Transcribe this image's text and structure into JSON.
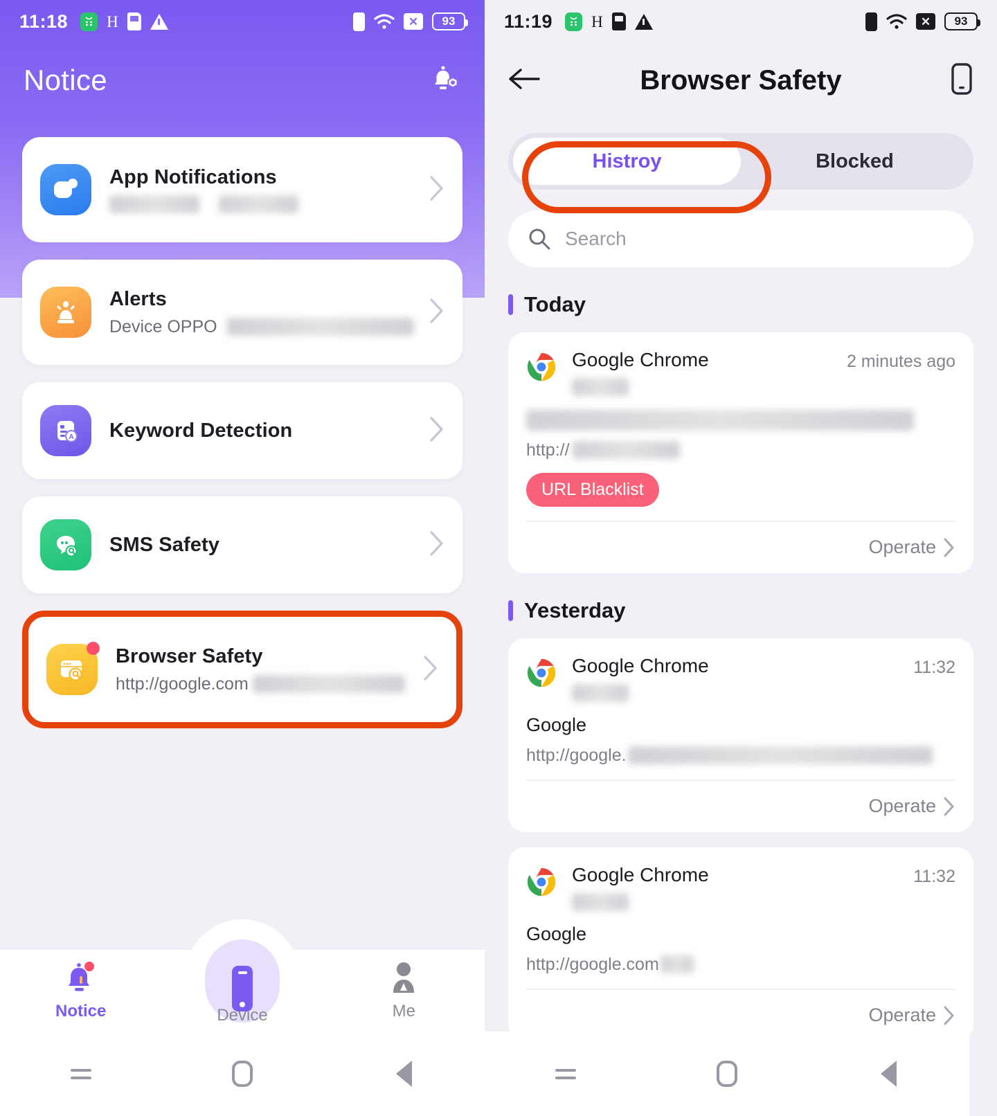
{
  "left": {
    "status_bar": {
      "time": "11:18",
      "icons": [
        "green-app-icon",
        "network-h-icon",
        "sim-card-icon",
        "warning-triangle-icon"
      ],
      "right_icons": [
        "vibrate-icon",
        "wifi-icon",
        "signal-x-icon"
      ],
      "battery_level": "93"
    },
    "header": {
      "title": "Notice",
      "action_icon": "bell-settings-icon"
    },
    "items": [
      {
        "title": "App Notifications",
        "subtitle": "",
        "subtitle_redacted": true,
        "icon": "app-notifications-icon",
        "badge": false,
        "chevron": "chevron-right-icon"
      },
      {
        "title": "Alerts",
        "subtitle": "Device OPPO",
        "subtitle_redacted": true,
        "icon": "alerts-siren-icon",
        "badge": false,
        "chevron": "chevron-right-icon"
      },
      {
        "title": "Keyword Detection",
        "subtitle": "",
        "subtitle_redacted": false,
        "icon": "keyword-detection-icon",
        "badge": false,
        "chevron": "chevron-right-icon"
      },
      {
        "title": "SMS Safety",
        "subtitle": "",
        "subtitle_redacted": false,
        "icon": "sms-safety-icon",
        "badge": false,
        "chevron": "chevron-right-icon"
      },
      {
        "title": "Browser Safety",
        "subtitle": "http://google.com",
        "subtitle_redacted": true,
        "icon": "browser-safety-icon",
        "badge": true,
        "chevron": "chevron-right-icon",
        "highlighted": true
      }
    ],
    "bottom_nav": [
      {
        "label": "Notice",
        "icon": "bell-icon",
        "active": true,
        "badge": true
      },
      {
        "label": "Device",
        "icon": "phone-icon",
        "active": false,
        "badge": false
      },
      {
        "label": "Me",
        "icon": "person-icon",
        "active": false,
        "badge": false
      }
    ],
    "android_nav": [
      "recents-icon",
      "home-icon",
      "back-icon"
    ]
  },
  "right": {
    "status_bar": {
      "time": "11:19",
      "icons": [
        "green-app-icon",
        "network-h-icon",
        "sim-card-icon",
        "warning-triangle-icon"
      ],
      "right_icons": [
        "vibrate-icon",
        "wifi-icon",
        "signal-x-icon"
      ],
      "battery_level": "93"
    },
    "header": {
      "title": "Browser Safety",
      "back_icon": "back-arrow-icon",
      "action_icon": "device-phone-icon"
    },
    "tabs": [
      {
        "label": "Histroy",
        "active": true,
        "highlighted": true
      },
      {
        "label": "Blocked",
        "active": false,
        "highlighted": false
      }
    ],
    "search": {
      "placeholder": "Search",
      "value": "",
      "icon": "search-icon"
    },
    "sections": [
      {
        "title": "Today",
        "cards": [
          {
            "app": "Google Chrome",
            "app_sub_redacted": true,
            "time": "2 minutes ago",
            "title": "",
            "title_redacted": true,
            "url": "http://",
            "url_redacted": true,
            "badge": "URL Blacklist",
            "badge_color": "#FA6179",
            "operate_label": "Operate",
            "icon": "chrome-icon"
          }
        ]
      },
      {
        "title": "Yesterday",
        "cards": [
          {
            "app": "Google Chrome",
            "app_sub_redacted": true,
            "time": "11:32",
            "title": "Google",
            "title_redacted": false,
            "url": "http://google.",
            "url_redacted": true,
            "badge": "",
            "operate_label": "Operate",
            "icon": "chrome-icon"
          },
          {
            "app": "Google Chrome",
            "app_sub_redacted": true,
            "time": "11:32",
            "title": "Google",
            "title_redacted": false,
            "url": "http://google.com",
            "url_redacted": true,
            "badge": "",
            "operate_label": "Operate",
            "icon": "chrome-icon"
          }
        ]
      }
    ],
    "android_nav": [
      "recents-icon",
      "home-icon",
      "back-icon"
    ]
  },
  "theme": {
    "accent_purple": "#7A5AF0",
    "highlight_red": "#E8420B",
    "badge_red": "#FA6179",
    "page_bg": "#F2EFF6"
  }
}
